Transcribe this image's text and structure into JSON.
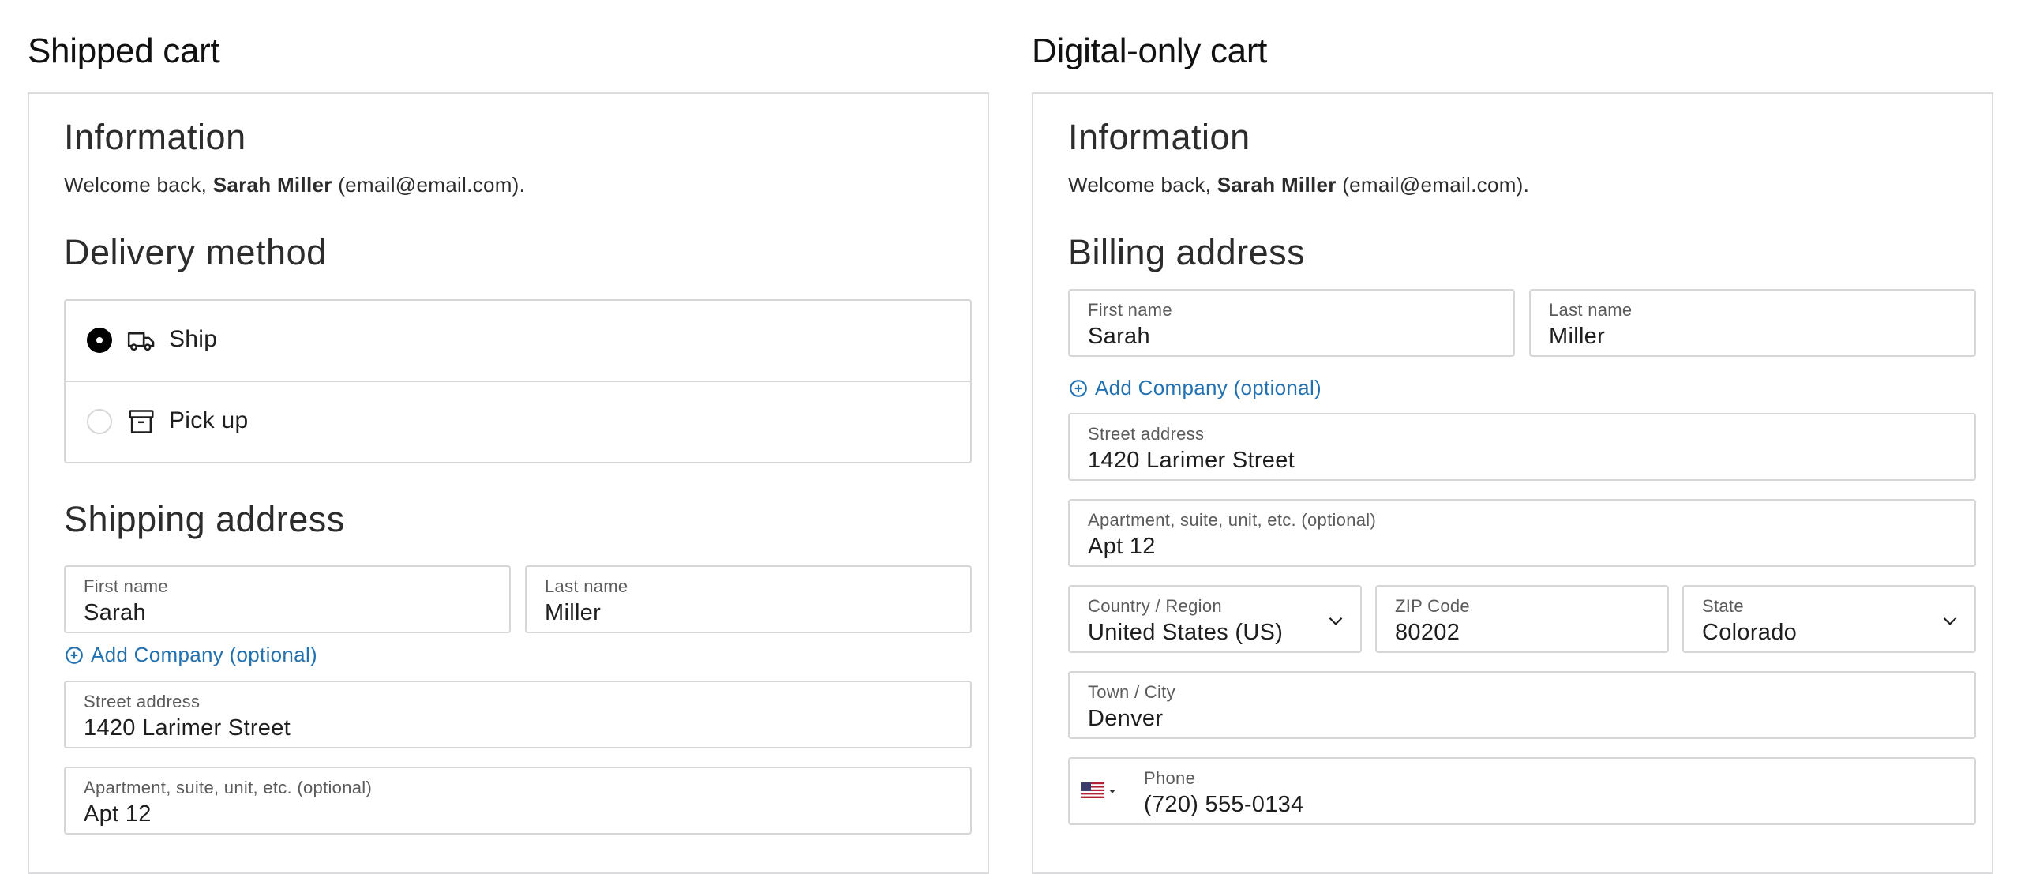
{
  "shipped_cart": {
    "title": "Shipped cart",
    "information": {
      "heading": "Information",
      "welcome_prefix": "Welcome back,",
      "user_name": "Sarah Miller",
      "email_text": "(email@email.com)."
    },
    "delivery": {
      "heading": "Delivery method",
      "options": [
        {
          "label": "Ship",
          "icon": "truck-icon",
          "selected": true
        },
        {
          "label": "Pick up",
          "icon": "store-box-icon",
          "selected": false
        }
      ]
    },
    "shipping": {
      "heading": "Shipping address",
      "first_name": {
        "label": "First name",
        "value": "Sarah"
      },
      "last_name": {
        "label": "Last name",
        "value": "Miller"
      },
      "add_company": "Add Company (optional)",
      "street": {
        "label": "Street address",
        "value": "1420 Larimer Street"
      },
      "apartment": {
        "label": "Apartment, suite, unit, etc. (optional)",
        "value": "Apt 12"
      }
    }
  },
  "digital_cart": {
    "title": "Digital-only cart",
    "information": {
      "heading": "Information",
      "welcome_prefix": "Welcome back,",
      "user_name": "Sarah Miller",
      "email_text": "(email@email.com)."
    },
    "billing": {
      "heading": "Billing address",
      "first_name": {
        "label": "First name",
        "value": "Sarah"
      },
      "last_name": {
        "label": "Last name",
        "value": "Miller"
      },
      "add_company": "Add Company (optional)",
      "street": {
        "label": "Street address",
        "value": "1420 Larimer Street"
      },
      "apartment": {
        "label": "Apartment, suite, unit, etc. (optional)",
        "value": "Apt 12"
      },
      "country": {
        "label": "Country / Region",
        "value": "United States (US)"
      },
      "zip": {
        "label": "ZIP Code",
        "value": "80202"
      },
      "state": {
        "label": "State",
        "value": "Colorado"
      },
      "city": {
        "label": "Town / City",
        "value": "Denver"
      },
      "phone": {
        "label": "Phone",
        "value": "(720) 555-0134",
        "flag": "us-flag-icon"
      }
    }
  },
  "colors": {
    "link": "#2271b1",
    "border": "#d6d6d8",
    "text": "#1e1e1e"
  }
}
